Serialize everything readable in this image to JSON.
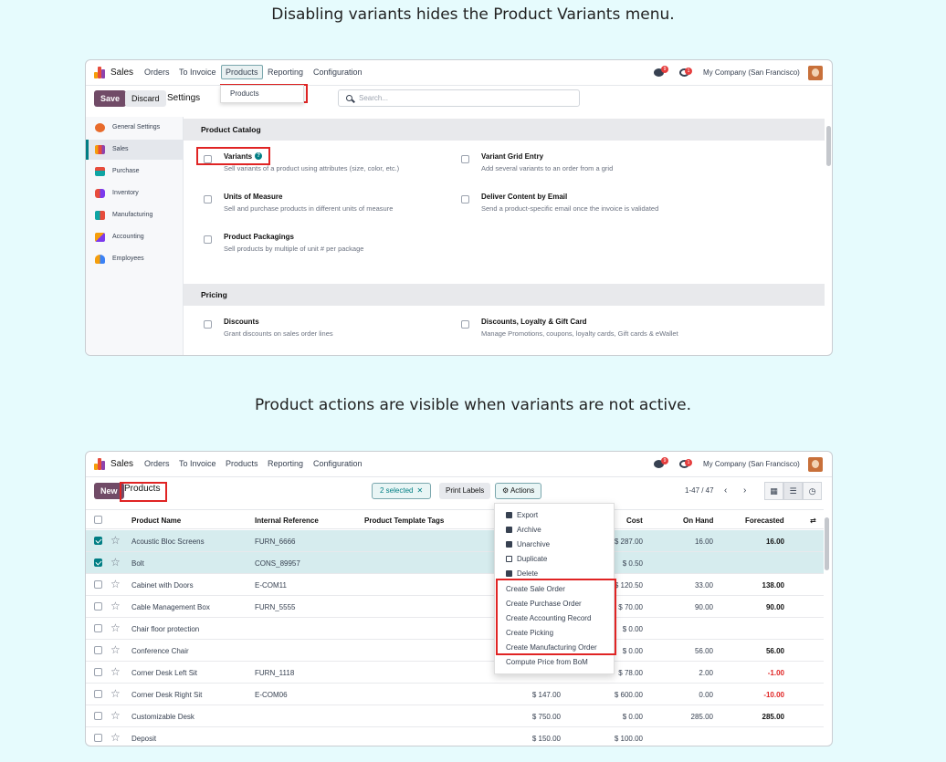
{
  "captions": {
    "top": "Disabling variants hides the Product Variants menu.",
    "bottom": "Product actions are visible when variants are not active."
  },
  "nav": {
    "app": "Sales",
    "menus": [
      "Orders",
      "To Invoice",
      "Products",
      "Reporting",
      "Configuration"
    ],
    "company": "My Company (San Francisco)",
    "chat_count": "9",
    "activity_count": "1"
  },
  "settings": {
    "save": "Save",
    "discard": "Discard",
    "title": "Settings",
    "search_placeholder": "Search...",
    "dropdown_item": "Products",
    "sidebar": [
      "General Settings",
      "Sales",
      "Purchase",
      "Inventory",
      "Manufacturing",
      "Accounting",
      "Employees"
    ],
    "sections": [
      {
        "title": "Product Catalog",
        "items": [
          {
            "title": "Variants",
            "desc": "Sell variants of a product using attributes (size, color, etc.)"
          },
          {
            "title": "Variant Grid Entry",
            "desc": "Add several variants to an order from a grid"
          },
          {
            "title": "Units of Measure",
            "desc": "Sell and purchase products in different units of measure"
          },
          {
            "title": "Deliver Content by Email",
            "desc": "Send a product-specific email once the invoice is validated"
          },
          {
            "title": "Product Packagings",
            "desc": "Sell products by multiple of unit # per package"
          }
        ]
      },
      {
        "title": "Pricing",
        "items": [
          {
            "title": "Discounts",
            "desc": "Grant discounts on sales order lines"
          },
          {
            "title": "Discounts, Loyalty & Gift Card",
            "desc": "Manage Promotions, coupons, loyalty cards, Gift cards & eWallet"
          }
        ]
      }
    ]
  },
  "products": {
    "new": "New",
    "title": "Products",
    "selected": "2 selected",
    "print_labels": "Print Labels",
    "actions": "Actions",
    "pager": "1-47 / 47",
    "columns": [
      "Product Name",
      "Internal Reference",
      "Product Template Tags",
      "Cost",
      "On Hand",
      "Forecasted"
    ],
    "rows": [
      {
        "name": "Acoustic Bloc Screens",
        "ref": "FURN_6666",
        "price": "",
        "cost": "$ 287.00",
        "onhand": "16.00",
        "forecast": "16.00",
        "selected": true
      },
      {
        "name": "Bolt",
        "ref": "CONS_89957",
        "price": "",
        "cost": "$ 0.50",
        "onhand": "",
        "forecast": "",
        "selected": true
      },
      {
        "name": "Cabinet with Doors",
        "ref": "E-COM11",
        "price": "",
        "cost": "$ 120.50",
        "onhand": "33.00",
        "forecast": "138.00",
        "selected": false
      },
      {
        "name": "Cable Management Box",
        "ref": "FURN_5555",
        "price": "",
        "cost": "$ 70.00",
        "onhand": "90.00",
        "forecast": "90.00",
        "selected": false
      },
      {
        "name": "Chair floor protection",
        "ref": "",
        "price": "",
        "cost": "$ 0.00",
        "onhand": "",
        "forecast": "",
        "selected": false
      },
      {
        "name": "Conference Chair",
        "ref": "",
        "price": "",
        "cost": "$ 0.00",
        "onhand": "56.00",
        "forecast": "56.00",
        "selected": false
      },
      {
        "name": "Corner Desk Left Sit",
        "ref": "FURN_1118",
        "price": "",
        "cost": "$ 78.00",
        "onhand": "2.00",
        "forecast": "-1.00",
        "selected": false
      },
      {
        "name": "Corner Desk Right Sit",
        "ref": "E-COM06",
        "price": "$ 147.00",
        "cost": "$ 600.00",
        "onhand": "0.00",
        "forecast": "-10.00",
        "selected": false
      },
      {
        "name": "Customizable Desk",
        "ref": "",
        "price": "$ 750.00",
        "cost": "$ 0.00",
        "onhand": "285.00",
        "forecast": "285.00",
        "selected": false
      },
      {
        "name": "Deposit",
        "ref": "",
        "price": "$ 150.00",
        "cost": "$ 100.00",
        "onhand": "",
        "forecast": "",
        "selected": false
      }
    ],
    "actions_menu": [
      "Export",
      "Archive",
      "Unarchive",
      "Duplicate",
      "Delete",
      "Create Sale Order",
      "Create Purchase Order",
      "Create Accounting Record",
      "Create Picking",
      "Create Manufacturing Order",
      "Compute Price from BoM"
    ]
  },
  "colors": {
    "accent": "#017e84",
    "primary": "#714b67",
    "highlight": "#e02424"
  }
}
